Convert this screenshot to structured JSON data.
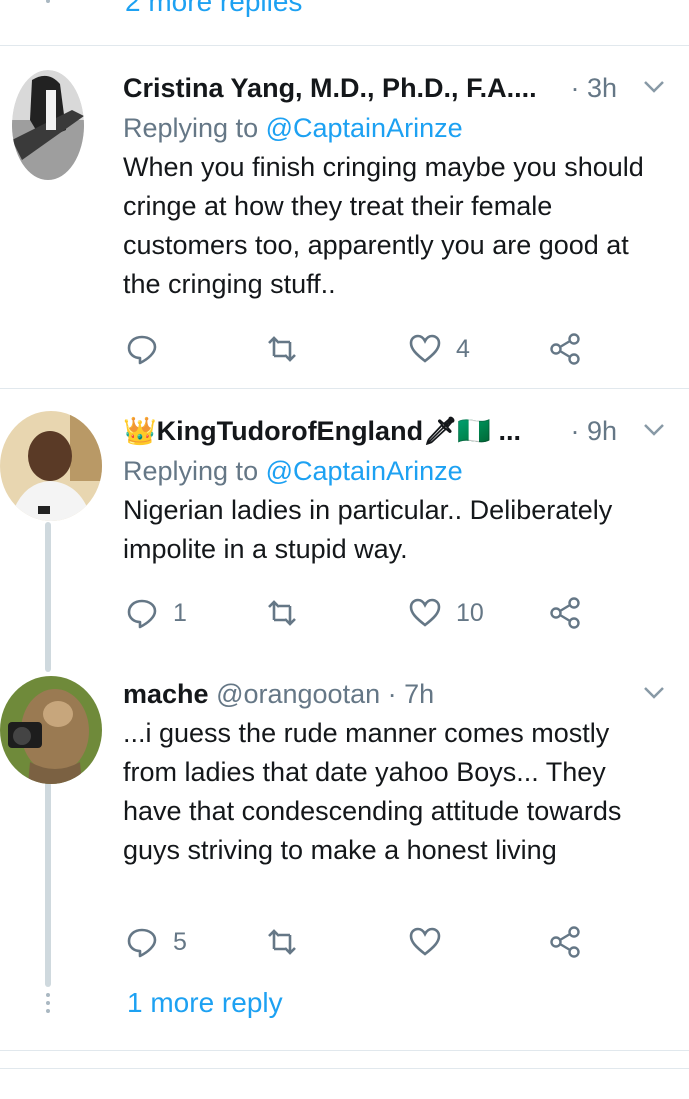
{
  "top_more": {
    "label": "2 more replies"
  },
  "tweets": [
    {
      "name": "Cristina Yang, M.D., Ph.D., F.A....",
      "handle": "",
      "time": "· 3h",
      "replying_prefix": "Replying to ",
      "replying_to": "@CaptainArinze",
      "body": "When you finish cringing maybe you should cringe at how they treat their female customers too, apparently you are good at the cringing stuff..",
      "reply_count": "",
      "retweet_count": "",
      "like_count": "4"
    },
    {
      "name": "👑KingTudorofEngland🗡🇳🇬 ...",
      "handle": "",
      "time": "· 9h",
      "replying_prefix": "Replying to ",
      "replying_to": "@CaptainArinze",
      "body": "Nigerian ladies in particular.. Deliberately impolite in a stupid way.",
      "reply_count": "1",
      "retweet_count": "",
      "like_count": "10"
    },
    {
      "name": "mache",
      "handle": "@orangootan",
      "time": "· 7h",
      "body": "...i guess the rude manner comes mostly from ladies that date yahoo Boys... They have that condescending attitude towards guys striving to make a honest living",
      "reply_count": "5",
      "retweet_count": "",
      "like_count": ""
    }
  ],
  "more_reply": {
    "label": "1 more reply"
  },
  "colors": {
    "link": "#1da1f2",
    "muted": "#657786",
    "text": "#14171a",
    "divider": "#e1e8ed"
  },
  "icons": [
    "reply-icon",
    "retweet-icon",
    "like-icon",
    "share-icon",
    "chevron-down-icon"
  ]
}
